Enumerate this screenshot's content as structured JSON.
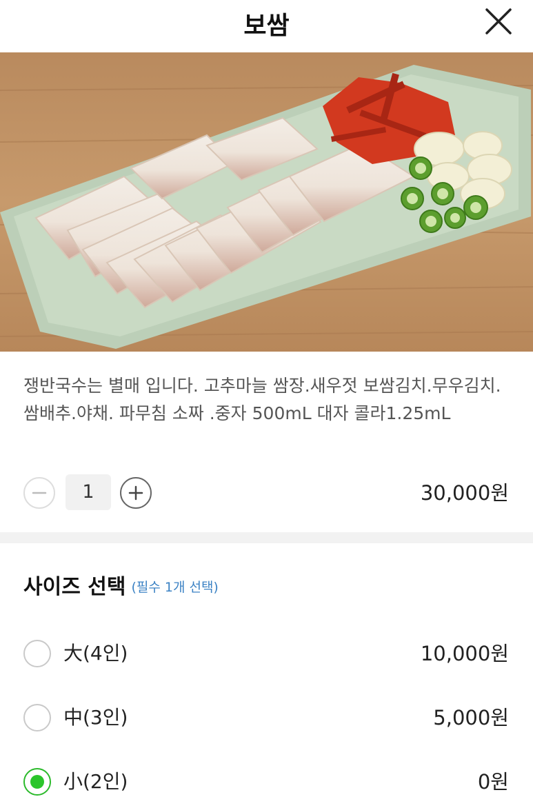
{
  "header": {
    "title": "보쌈"
  },
  "product": {
    "description": "쟁반국수는 별매 입니다. 고추마늘 쌈장.새우젓 보쌈김치.무우김치.쌈배추.야채. 파무침 소짜 .중자 500mL 대자 콜라1.25mL",
    "quantity": "1",
    "price": "30,000원"
  },
  "size_section": {
    "title": "사이즈 선택",
    "requirement": "(필수 1개 선택)",
    "options": [
      {
        "label": "大(4인)",
        "price": "10,000원",
        "selected": false
      },
      {
        "label": "中(3인)",
        "price": "5,000원",
        "selected": false
      },
      {
        "label": "小(2인)",
        "price": "0원",
        "selected": true
      }
    ]
  },
  "colors": {
    "accent_green": "#2bc52b",
    "link_blue": "#3b82c4"
  }
}
